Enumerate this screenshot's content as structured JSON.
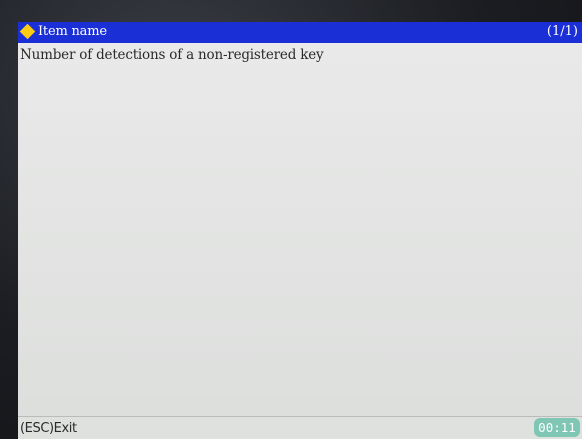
{
  "header": {
    "title": "Item name",
    "page_indicator": "(1/1)",
    "icon": "diamond-icon",
    "color": "#1b2fd6"
  },
  "content": {
    "item_text": "Number of detections of a non-registered key"
  },
  "footer": {
    "exit_label": "(ESC)Exit",
    "timer": "00:11",
    "timer_color": "#7fc6b5"
  }
}
